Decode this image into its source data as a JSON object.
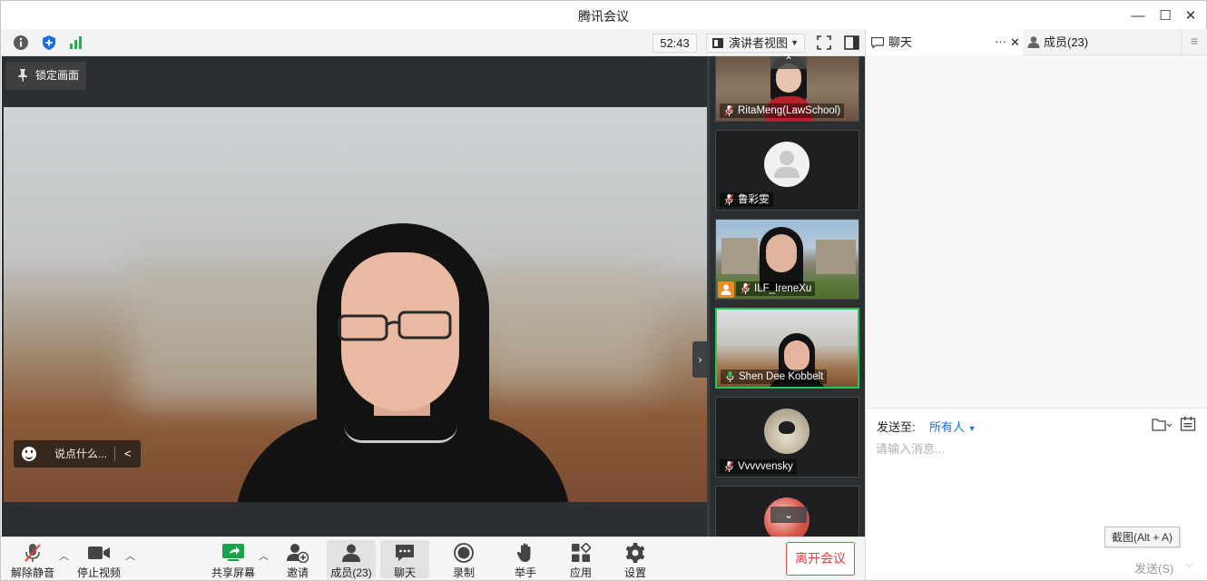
{
  "window": {
    "title": "腾讯会议",
    "controls": {
      "minimize": "—",
      "maximize": "☐",
      "close": "✕"
    }
  },
  "topbar": {
    "timer": "52:43",
    "view_mode": "演讲者视图",
    "colors": {
      "shield": "#1d6fe0",
      "signal": "#21b24b"
    }
  },
  "stage": {
    "lock_label": "锁定画面",
    "say_placeholder": "说点什么...",
    "collapse_glyph": "›"
  },
  "gallery": {
    "tiles": [
      {
        "name": "RitaMeng(LawSchool)",
        "muted": true
      },
      {
        "name": "鲁彩雯",
        "muted": true
      },
      {
        "name": "ILF_IreneXu",
        "muted": true,
        "host": true
      },
      {
        "name": "Shen Dee Kobbelt",
        "muted": false,
        "speaking": true
      },
      {
        "name": "Vvvvvensky",
        "muted": true
      },
      {
        "name": "",
        "muted": true
      }
    ],
    "scroll_up": "⌃",
    "scroll_down": "⌄",
    "colors": {
      "speaking_border": "#27c65a",
      "mic_on": "#27c65a",
      "mic_off": "#e2403a",
      "host_badge": "#f08a24"
    }
  },
  "toolbar": {
    "unmute": "解除静音",
    "stop_video": "停止视频",
    "share_screen": "共享屏幕",
    "invite": "邀请",
    "members": "成员(23)",
    "chat": "聊天",
    "record": "录制",
    "raise_hand": "举手",
    "apps": "应用",
    "settings": "设置",
    "leave": "离开会议",
    "colors": {
      "share_green": "#1aa34a",
      "leave_red": "#e23b3b"
    }
  },
  "chat": {
    "tab_chat": "聊天",
    "tab_more": "···",
    "tab_close": "✕",
    "tab_members": "成员(23)",
    "send_to_label": "发送至:",
    "recipient": "所有人",
    "placeholder": "请输入消息...",
    "screenshot_tooltip": "截图(Alt + A)",
    "send_button": "发送(S)",
    "recipient_color": "#1a6fe0"
  }
}
